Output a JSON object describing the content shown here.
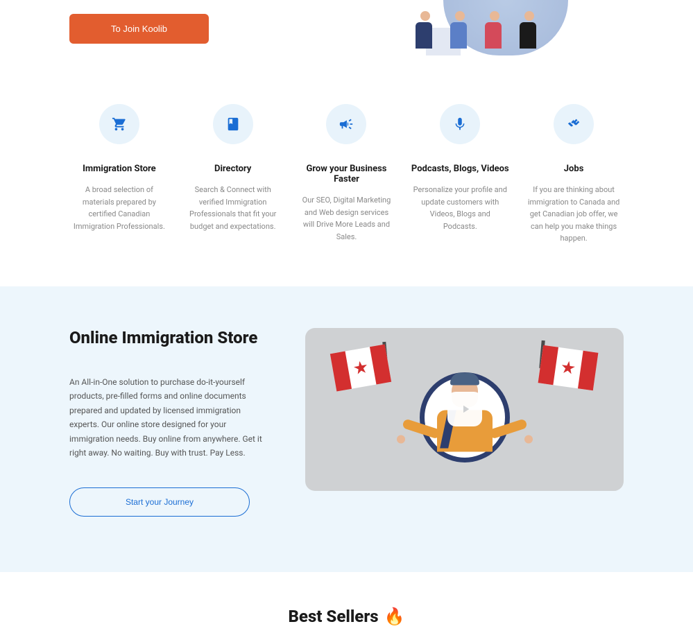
{
  "hero": {
    "cta_label": "To Join Koolib"
  },
  "features": [
    {
      "icon": "cart",
      "title": "Immigration Store",
      "desc": "A broad selection of materials prepared by certified Canadian Immigration Professionals."
    },
    {
      "icon": "book",
      "title": "Directory",
      "desc": "Search & Connect with verified Immigration Professionals that fit your budget and expectations."
    },
    {
      "icon": "megaphone",
      "title": "Grow your Business Faster",
      "desc": "Our SEO, Digital Marketing and Web design services will Drive More Leads and Sales."
    },
    {
      "icon": "mic",
      "title": "Podcasts, Blogs, Videos",
      "desc": "Personalize your profile and update customers with Videos, Blogs and Podcasts."
    },
    {
      "icon": "handshake",
      "title": "Jobs",
      "desc": "If you are thinking about immigration to Canada and get Canadian job offer, we can help you make things happen."
    }
  ],
  "store": {
    "title": "Online Immigration Store",
    "desc": "An All-in-One solution to purchase do-it-yourself products, pre-filled forms and online documents prepared and updated by licensed immigration experts. Our online store designed for your immigration needs. Buy online from anywhere. Get it right away. No waiting. Buy with trust. Pay Less.",
    "button_label": "Start your Journey"
  },
  "bestsellers": {
    "title": "Best Sellers",
    "emoji": "🔥"
  }
}
